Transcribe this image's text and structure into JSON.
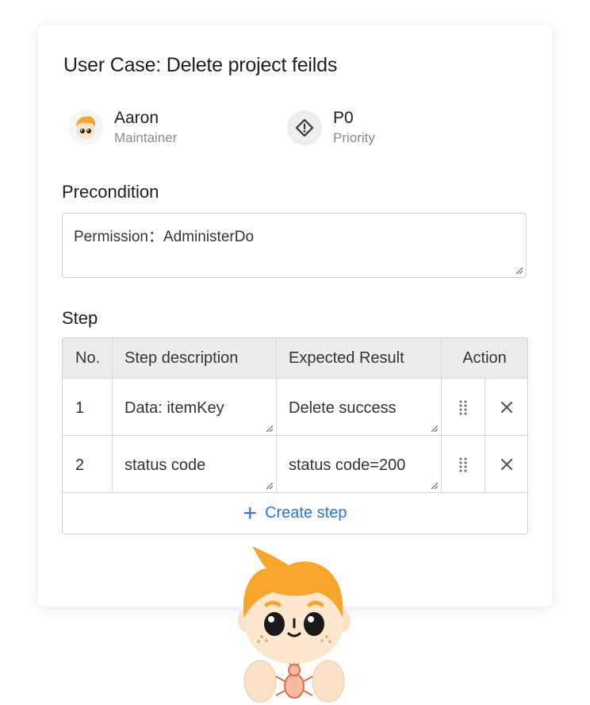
{
  "card": {
    "title": "User Case: Delete project feilds"
  },
  "maintainer": {
    "name": "Aaron",
    "role": "Maintainer",
    "icon": "avatar-boy"
  },
  "priority": {
    "value": "P0",
    "label": "Priority",
    "icon": "diamond-alert-icon"
  },
  "precondition": {
    "label": "Precondition",
    "value": "Permission：AdministerDo"
  },
  "step": {
    "label": "Step",
    "columns": [
      "No.",
      "Step description",
      "Expected Result",
      "Action"
    ],
    "rows": [
      {
        "no": "1",
        "description": "Data: itemKey",
        "expected": "Delete success"
      },
      {
        "no": "2",
        "description": "status code",
        "expected": "status code=200"
      }
    ],
    "create_label": "Create step"
  },
  "colors": {
    "accent": "#2c74e6",
    "mascot_hair": "#f7a52b",
    "bug": "#e26a4a"
  }
}
